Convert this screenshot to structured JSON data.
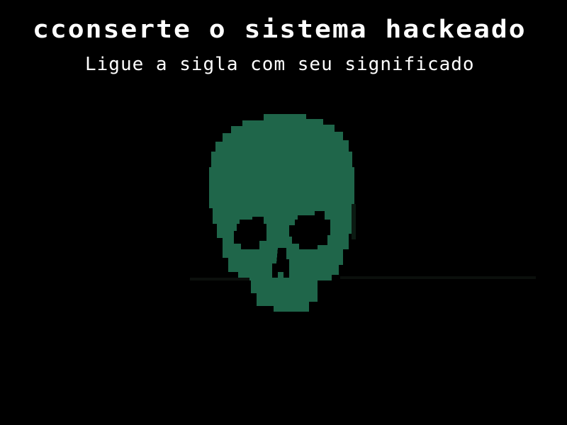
{
  "game": {
    "title": "cconserte o sistema hackeado",
    "instruction": "Ligue a sigla com seu significado"
  },
  "skull": {
    "icon": "skull-icon",
    "color": "#1f664a"
  },
  "colors": {
    "background": "#000000",
    "text": "#ffffff"
  }
}
